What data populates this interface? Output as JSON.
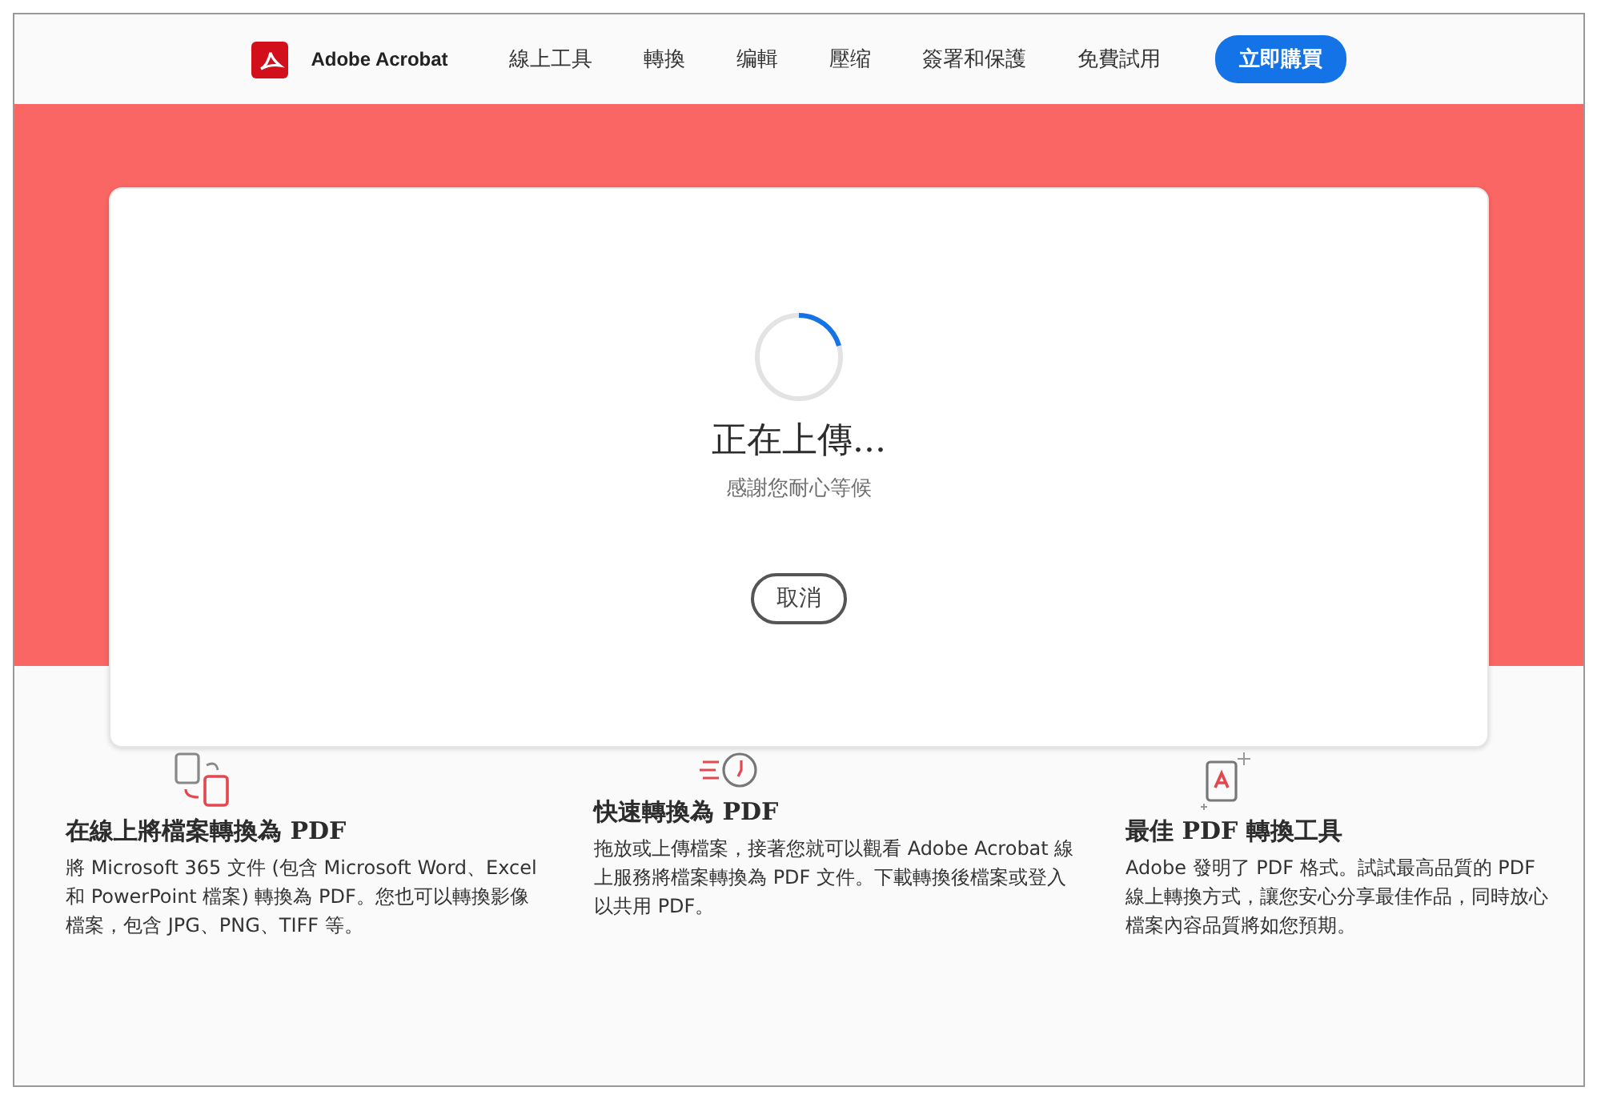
{
  "header": {
    "brand": "Adobe Acrobat",
    "nav": [
      "線上工具",
      "轉換",
      "编輯",
      "壓缩",
      "簽署和保護",
      "免費試用"
    ],
    "cta": "立即購買"
  },
  "upload": {
    "title": "正在上傳...",
    "subtitle": "感謝您耐心等候",
    "cancel": "取消"
  },
  "features": [
    {
      "kind": "convert",
      "title": "在線上將檔案轉換為 PDF",
      "text": "將 Microsoft 365 文件 (包含 Microsoft Word、Excel 和 PowerPoint 檔案) 轉換為 PDF。您也可以轉換影像檔案，包含 JPG、PNG、TIFF 等。"
    },
    {
      "kind": "fast",
      "title": "快速轉換為 PDF",
      "text": "拖放或上傳檔案，接著您就可以觀看 Adobe Acrobat 線上服務將檔案轉換為 PDF 文件。下載轉換後檔案或登入以共用 PDF。"
    },
    {
      "kind": "best",
      "title": "最佳 PDF 轉換工具",
      "text": "Adobe 發明了 PDF 格式。試試最高品質的 PDF 線上轉換方式，讓您安心分享最佳作品，同時放心檔案內容品質將如您預期。"
    }
  ]
}
